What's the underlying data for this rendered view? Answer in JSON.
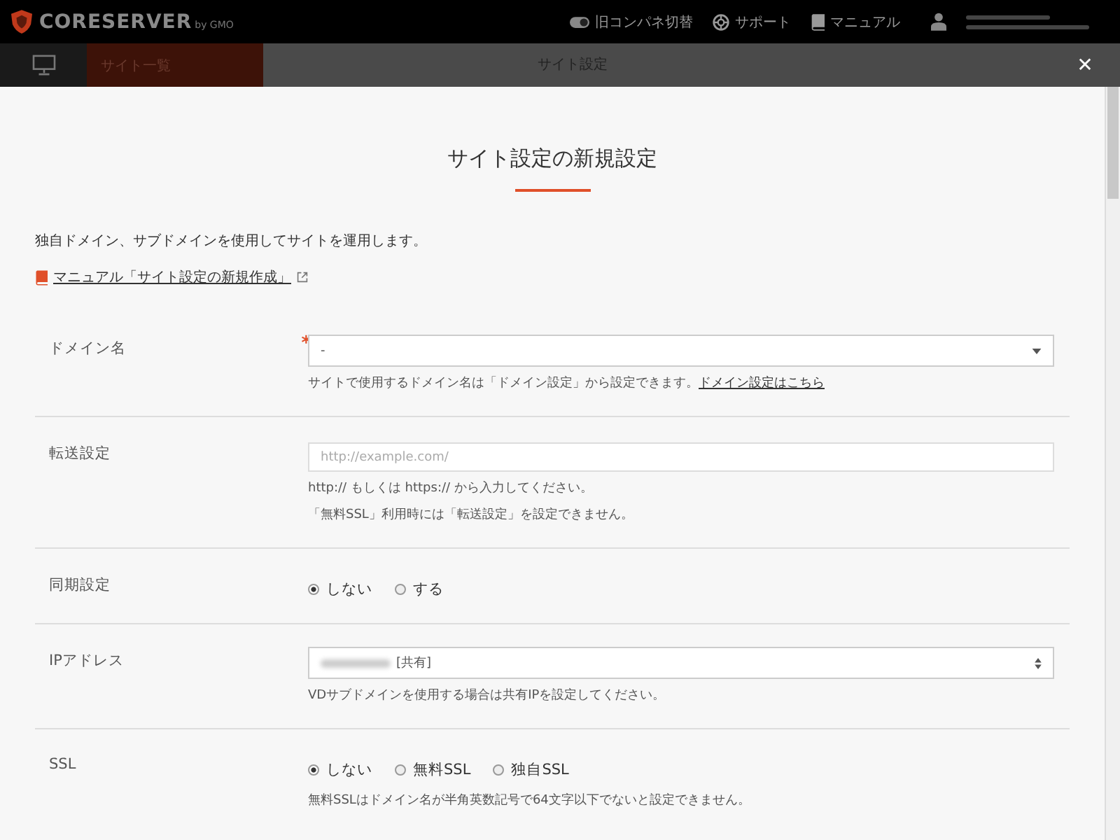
{
  "header": {
    "logo": "CORESERVER",
    "logo_sub": "by GMO",
    "links": [
      {
        "kind": "toggle",
        "label": "旧コンパネ切替"
      },
      {
        "kind": "support",
        "label": "サポート"
      },
      {
        "kind": "manual",
        "label": "マニュアル"
      }
    ]
  },
  "subbar": {
    "tab": "サイト一覧",
    "title": "サイト設定",
    "close": "✕"
  },
  "modal": {
    "title": "サイト設定の新規設定",
    "description": "独自ドメイン、サブドメインを使用してサイトを運用します。",
    "manual_link": "マニュアル「サイト設定の新規作成」",
    "fields": [
      {
        "kind": "select",
        "label": "ドメイン名",
        "required_mark": "*",
        "value": "-",
        "hints": [
          "サイトで使用するドメイン名は「ドメイン設定」から設定できます。"
        ],
        "hint_link": "ドメイン設定はこちら"
      },
      {
        "kind": "text",
        "label": "転送設定",
        "placeholder": "http://example.com/",
        "hints": [
          "http:// もしくは https:// から入力してください。",
          "「無料SSL」利用時には「転送設定」を設定できません。"
        ]
      },
      {
        "kind": "radio",
        "label": "同期設定",
        "options": [
          {
            "label": "しない",
            "selected": true
          },
          {
            "label": "する",
            "selected": false
          }
        ]
      },
      {
        "kind": "ip_select",
        "label": "IPアドレス",
        "value": "[共有]",
        "hints": [
          "VDサブドメインを使用する場合は共有IPを設定してください。"
        ]
      },
      {
        "kind": "radio",
        "label": "SSL",
        "options": [
          {
            "label": "しない",
            "selected": true
          },
          {
            "label": "無料SSL",
            "selected": false
          },
          {
            "label": "独自SSL",
            "selected": false
          }
        ],
        "hints": [
          "無料SSLはドメイン名が半角英数記号で64文字以下でないと設定できません。"
        ]
      }
    ]
  }
}
